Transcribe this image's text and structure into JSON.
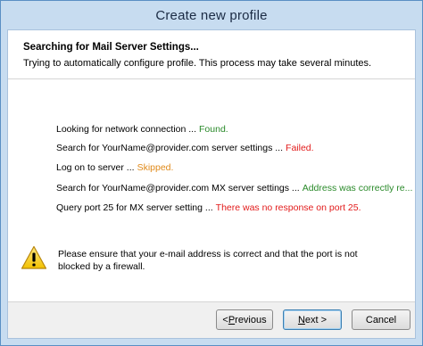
{
  "window": {
    "title": "Create new profile"
  },
  "header": {
    "title": "Searching for Mail Server Settings...",
    "subtitle": "Trying to automatically configure profile. This process may take several minutes."
  },
  "steps": [
    {
      "text": "Looking for network connection ...",
      "result": "Found.",
      "status": "ok"
    },
    {
      "text": "Search for YourName@provider.com server settings ...",
      "result": "Failed.",
      "status": "fail"
    },
    {
      "text": "Log on to server ...",
      "result": "Skipped.",
      "status": "skip"
    },
    {
      "text": "Search for YourName@provider.com MX server settings ...",
      "result": "Address was correctly re...",
      "status": "ok"
    },
    {
      "text": "Query port 25 for MX server setting ...",
      "result": "There was no response on port 25.",
      "status": "fail"
    }
  ],
  "warning": {
    "icon": "warning-icon",
    "line1": "Please ensure that your e-mail address is correct and that the port is not",
    "line2": "blocked by a firewall."
  },
  "buttons": {
    "previous": {
      "pre": "< ",
      "accel": "P",
      "post": "revious"
    },
    "next": {
      "pre": "",
      "accel": "N",
      "post": "ext >"
    },
    "cancel": {
      "pre": "",
      "accel": "",
      "post": "Cancel"
    }
  },
  "colors": {
    "ok": "#2a8a2a",
    "fail": "#e21b1b",
    "skip": "#e08a1a",
    "frame": "#c7dcf0"
  }
}
